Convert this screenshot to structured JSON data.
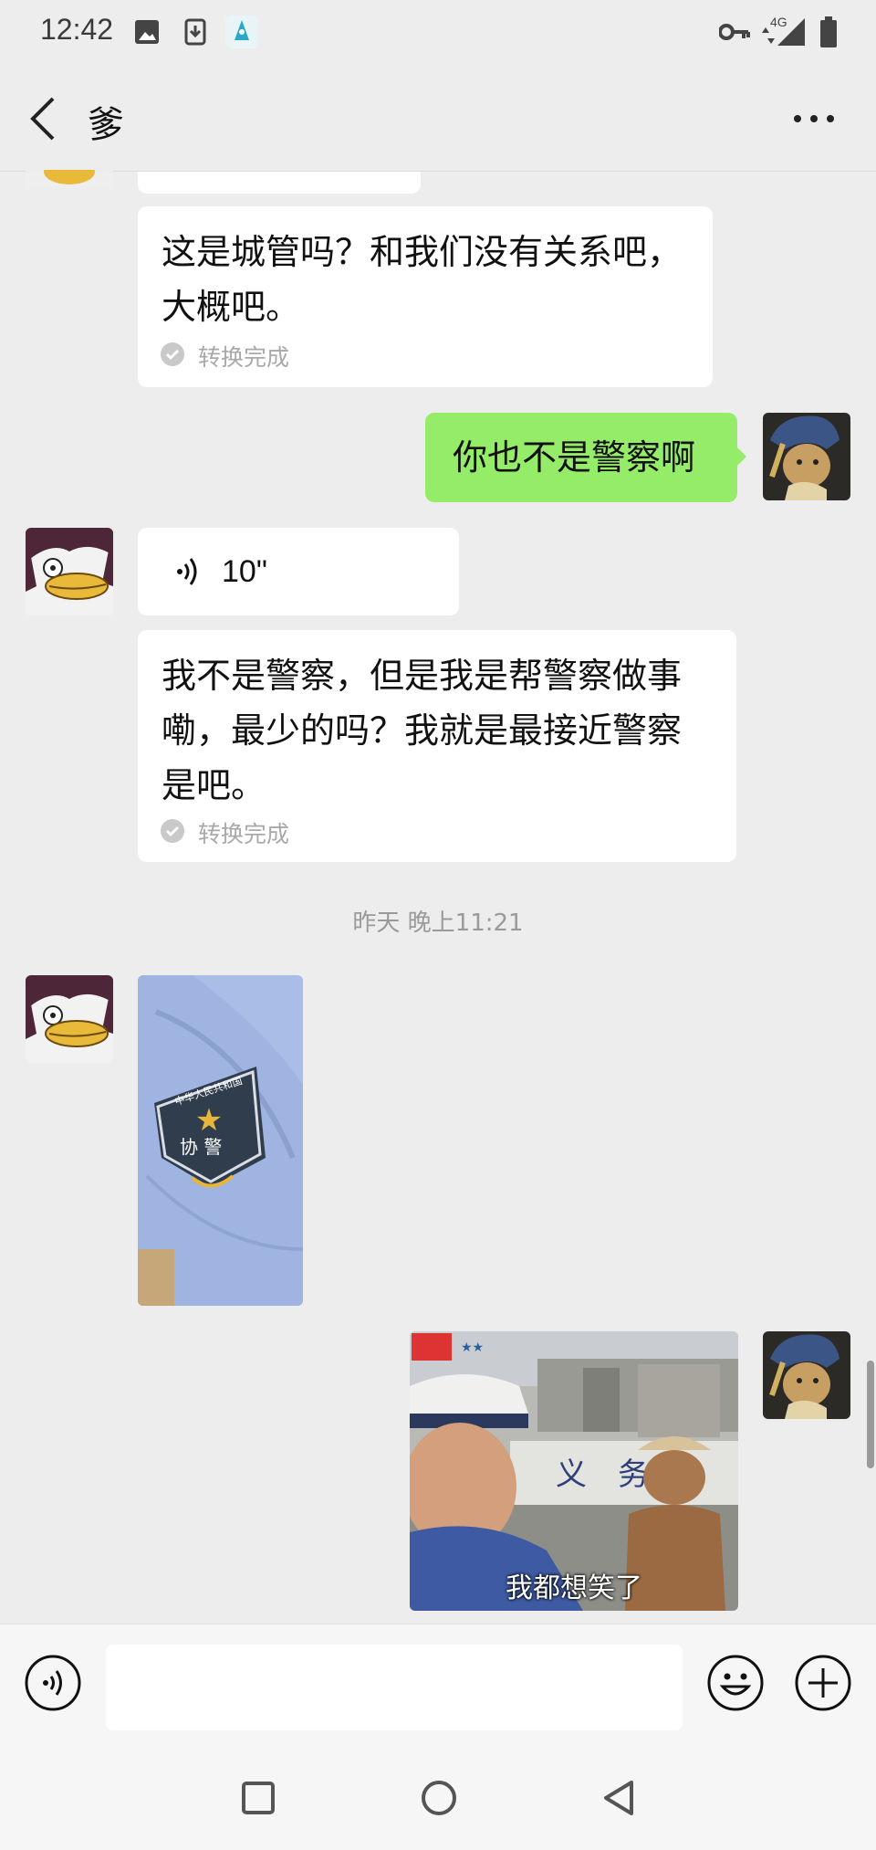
{
  "status_bar": {
    "time": "12:42",
    "network": "4G"
  },
  "header": {
    "title": "爹"
  },
  "messages": {
    "m1": {
      "text_line1": "这是城管吗？和我们没有关系吧，",
      "text_line2": "大概吧。",
      "status": "转换完成"
    },
    "m2": {
      "text": "你也不是警察啊"
    },
    "m3": {
      "duration": "10\""
    },
    "m4": {
      "text_line1": "我不是警察，但是我是帮警察做事",
      "text_line2": "嘞，最少的吗？我就是最接近警察",
      "text_line3": "是吧。",
      "status": "转换完成"
    },
    "time_separator": "昨天 晚上11:21",
    "m5": {
      "badge_top": "中华人民共和国",
      "badge_main": "协 警"
    },
    "m6": {
      "caption": "我都想笑了"
    }
  },
  "colors": {
    "sent_bubble": "#95ec69",
    "received_bubble": "#ffffff",
    "background": "#ededed"
  }
}
